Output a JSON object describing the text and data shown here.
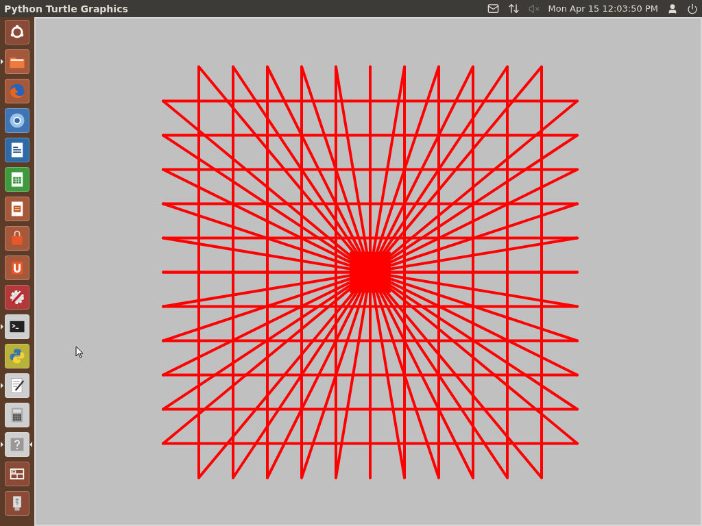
{
  "window": {
    "title": "Python Turtle Graphics"
  },
  "panel": {
    "clock": "Mon Apr 15 12:03:50 PM",
    "volume_muted": true
  },
  "launcher": [
    {
      "kind": "dash",
      "running": false,
      "focused": false
    },
    {
      "kind": "files",
      "running": true,
      "focused": false
    },
    {
      "kind": "firefox",
      "running": false,
      "focused": false
    },
    {
      "kind": "chromium",
      "running": false,
      "focused": false
    },
    {
      "kind": "writer",
      "running": false,
      "focused": false
    },
    {
      "kind": "calc",
      "running": false,
      "focused": false
    },
    {
      "kind": "impress",
      "running": false,
      "focused": false
    },
    {
      "kind": "software-center",
      "running": false,
      "focused": false
    },
    {
      "kind": "ubuntu-one",
      "running": false,
      "focused": false
    },
    {
      "kind": "settings",
      "running": false,
      "focused": false
    },
    {
      "kind": "terminal",
      "running": true,
      "focused": false
    },
    {
      "kind": "python",
      "running": false,
      "focused": false
    },
    {
      "kind": "text-editor",
      "running": true,
      "focused": false
    },
    {
      "kind": "calculator",
      "running": false,
      "focused": false
    },
    {
      "kind": "help",
      "running": true,
      "focused": true
    },
    {
      "kind": "workspaces",
      "running": false,
      "focused": false
    },
    {
      "kind": "usb",
      "running": false,
      "focused": false
    }
  ]
}
